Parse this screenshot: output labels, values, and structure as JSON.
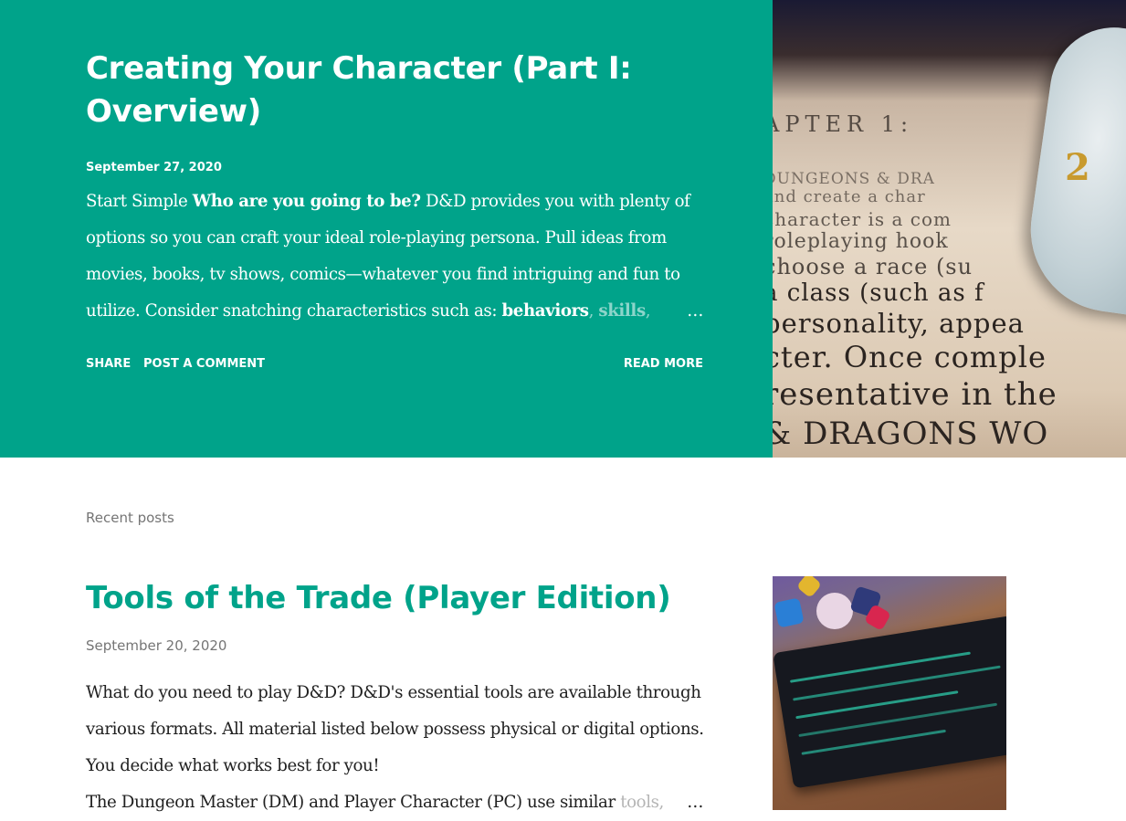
{
  "featured": {
    "title": "Creating Your Character (Part I: Overview)",
    "date": "September 27, 2020",
    "snippet": {
      "lead": "Start Simple ",
      "bold_question": "Who are you going to be?",
      "body": " D&D provides you with plenty of options so you can craft your ideal role-playing persona. Pull ideas from movies, books, tv shows, comics—whatever you find intriguing and fun to utilize. Consider snatching characteristics such as: ",
      "bold_term_1": "behaviors",
      "separator": ", ",
      "bold_term_2": "skills",
      "trail": ",",
      "ellipsis": "…"
    },
    "actions": {
      "share": "SHARE",
      "comment": "POST A COMMENT",
      "read_more": "READ MORE"
    },
    "image_text": {
      "line1": "APTER 1:",
      "line2": "DUNGEONS & DRA",
      "line3": "and create a char",
      "line4": "character is a com",
      "line5": "roleplaying hook",
      "line6": "choose a race (su",
      "line7": "a class (such as f",
      "line8": "personality, appea",
      "line9": "cter. Once comple",
      "line10": "resentative in the",
      "line11": "& DRAGONS WO",
      "die_number": "2"
    }
  },
  "recent": {
    "label": "Recent posts",
    "posts": [
      {
        "title": "Tools of the Trade (Player Edition)",
        "date": "September 20, 2020",
        "snippet_line1": "What do you need to play D&D? D&D's essential tools are available through various formats. All material listed below possess physical or digital options. You decide what works best for you!",
        "snippet_line2": "The Dungeon Master (DM) and Player Character (PC) use similar ",
        "snippet_fade": "tools,",
        "ellipsis": "…"
      }
    ]
  },
  "colors": {
    "accent": "#00a38a",
    "text_dark": "#212121",
    "muted": "#757575"
  }
}
